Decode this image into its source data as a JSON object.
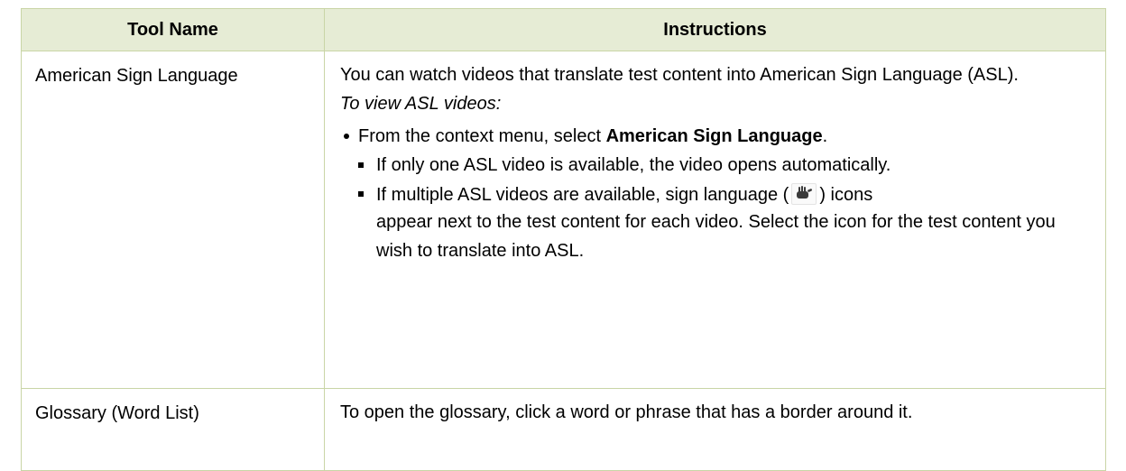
{
  "table": {
    "headers": {
      "tool_name": "Tool Name",
      "instructions": "Instructions"
    },
    "rows": [
      {
        "tool_name": "American Sign Language",
        "intro": "You can watch videos that translate test content into American Sign Language (ASL).",
        "sub_heading": "To view ASL videos:",
        "bullet_prefix": "From the context menu, select ",
        "bullet_bold": "American Sign Language",
        "bullet_suffix": ".",
        "sub_bullet_1": "If only one ASL video is available, the video opens automatically.",
        "sub_bullet_2_before_icon": "If multiple ASL videos are available, sign language (",
        "icon": "sign-language-icon",
        "sub_bullet_2_after_icon": ") icons",
        "sub_bullet_2_rest": "appear next to the test content for each video. Select the icon for the test content you wish to translate into ASL."
      },
      {
        "tool_name": "Glossary (Word List)",
        "instructions": "To open the glossary, click a word or phrase that has a border around it."
      }
    ]
  },
  "colors": {
    "header_bg": "#e6ecd5",
    "border": "#c9d5a6"
  }
}
